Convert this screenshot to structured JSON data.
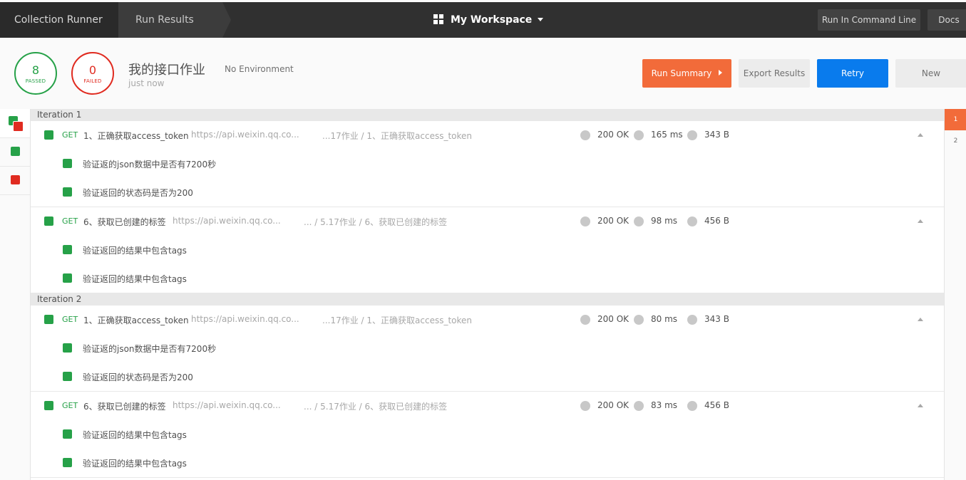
{
  "topbar": {
    "crumb_runner": "Collection Runner",
    "crumb_results": "Run Results",
    "workspace": "My Workspace",
    "cmd_button": "Run In Command Line",
    "docs_button": "Docs"
  },
  "summary": {
    "passed_count": "8",
    "passed_label": "PASSED",
    "failed_count": "0",
    "failed_label": "FAILED",
    "collection_name": "我的接口作业",
    "environment": "No Environment",
    "time": "just now",
    "run_summary": "Run Summary",
    "export": "Export Results",
    "retry": "Retry",
    "new": "New"
  },
  "iterations_nav": [
    "1",
    "2"
  ],
  "iterations": [
    {
      "label": "Iteration 1",
      "requests": [
        {
          "method": "GET",
          "name": "1、正确获取access_token",
          "url": "https://api.weixin.qq.co...",
          "path": "...17作业 / 1、正确获取access_token",
          "status": "200 OK",
          "time": "165 ms",
          "size": "343 B",
          "tests": [
            "验证返的json数据中是否有7200秒",
            "验证返回的状态码是否为200"
          ]
        },
        {
          "method": "GET",
          "name": "6、获取已创建的标签",
          "url": "https://api.weixin.qq.co...",
          "path": "... / 5.17作业 / 6、获取已创建的标签",
          "status": "200 OK",
          "time": "98 ms",
          "size": "456 B",
          "tests": [
            "验证返回的结果中包含tags",
            "验证返回的结果中包含tags"
          ]
        }
      ]
    },
    {
      "label": "Iteration 2",
      "requests": [
        {
          "method": "GET",
          "name": "1、正确获取access_token",
          "url": "https://api.weixin.qq.co...",
          "path": "...17作业 / 1、正确获取access_token",
          "status": "200 OK",
          "time": "80 ms",
          "size": "343 B",
          "tests": [
            "验证返的json数据中是否有7200秒",
            "验证返回的状态码是否为200"
          ]
        },
        {
          "method": "GET",
          "name": "6、获取已创建的标签",
          "url": "https://api.weixin.qq.co...",
          "path": "... / 5.17作业 / 6、获取已创建的标签",
          "status": "200 OK",
          "time": "83 ms",
          "size": "456 B",
          "tests": [
            "验证返回的结果中包含tags",
            "验证返回的结果中包含tags"
          ]
        }
      ]
    }
  ],
  "colors": {
    "pass": "#26a148",
    "fail": "#e02b20",
    "accent": "#f26b3a",
    "retry": "#097bed",
    "topbar": "#303030"
  }
}
